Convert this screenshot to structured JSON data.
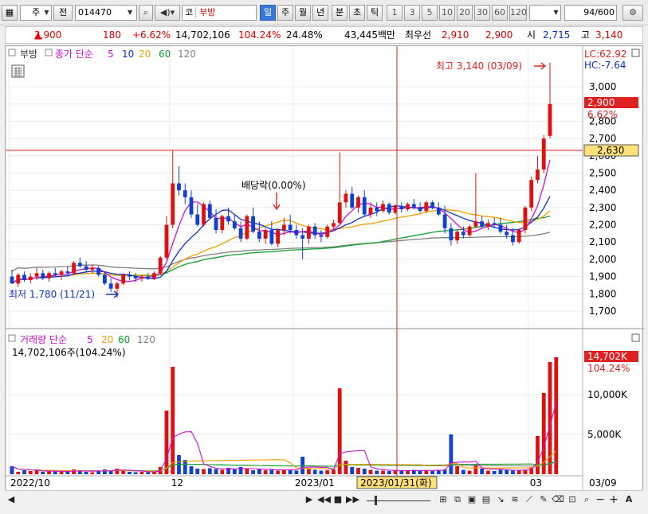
{
  "toolbar": {
    "market_label": "주",
    "type_label": "전",
    "stock_code": "014470",
    "market_kind": "코",
    "stock_name": "부방",
    "periods": [
      "일",
      "주",
      "월",
      "년",
      "분",
      "초",
      "틱"
    ],
    "selected_period": "일",
    "intervals": [
      "1",
      "3",
      "5",
      "10",
      "20",
      "30",
      "60",
      "120"
    ],
    "count": "94",
    "count_total": "/600"
  },
  "quote": {
    "price": "2,900",
    "change_arrow": "▲",
    "change": "180",
    "change_pct": "+6.62%",
    "volume": "14,702,106",
    "volume_ratio": "104.24%",
    "turnover": "24.48%",
    "amount": "43,445백만",
    "pref_label": "최우선",
    "bid": "2,910",
    "ask": "2,900",
    "open_label": "시",
    "open": "2,715",
    "high_label": "고",
    "high": "3,140"
  },
  "price_panel": {
    "name_tag": "부방",
    "legend_label": "종가 단순",
    "ma_periods": [
      "5",
      "10",
      "20",
      "60",
      "120"
    ],
    "lc": "LC:62.92",
    "hc": "HC:-7.64",
    "current_tag": "2,900",
    "pct_tag": "6.62%",
    "crosshair_tag": "2,630",
    "high_note": "최고 3,140 (03/09)",
    "low_note": "최저 1,780 (11/21)",
    "dividend_note": "배당락(0.00%)",
    "y_ticks": [
      "3,000",
      "2,900",
      "2,800",
      "2,700",
      "2,600",
      "2,500",
      "2,400",
      "2,300",
      "2,200",
      "2,100",
      "2,000",
      "1,900",
      "1,800",
      "1,700"
    ]
  },
  "volume_panel": {
    "legend_label": "거래량 단순",
    "ma_periods": [
      "5",
      "20",
      "60",
      "120"
    ],
    "volume_text": "14,702,106주(104.24%)",
    "current_tag": "14,702K",
    "pct_tag": "104.24%",
    "y_ticks": [
      "10,000K",
      "5,000K"
    ]
  },
  "x_axis": {
    "labels": [
      "2022/10",
      "12",
      "2023/01",
      "03"
    ],
    "crosshair_date": "2023/01/31(화)",
    "last_date": "03/09"
  },
  "colors": {
    "up": "#e01010",
    "down": "#1040d0",
    "ma5": "#d010d0",
    "ma10": "#1030c8",
    "ma20": "#f0a000",
    "ma60": "#10a030",
    "ma120": "#808080",
    "selected": "#3a78d8"
  },
  "chart_data": {
    "type": "candlestick",
    "price_ylim": [
      1700,
      3100
    ],
    "x_labels": [
      "2022/10",
      "12",
      "2023/01",
      "03"
    ],
    "candles": [
      [
        1900,
        1940,
        1860,
        1860
      ],
      [
        1860,
        1920,
        1840,
        1910
      ],
      [
        1910,
        1930,
        1870,
        1880
      ],
      [
        1880,
        1920,
        1860,
        1900
      ],
      [
        1900,
        1950,
        1880,
        1920
      ],
      [
        1920,
        1940,
        1880,
        1890
      ],
      [
        1890,
        1930,
        1870,
        1920
      ],
      [
        1920,
        1950,
        1900,
        1910
      ],
      [
        1910,
        1940,
        1880,
        1930
      ],
      [
        1930,
        1960,
        1910,
        1920
      ],
      [
        1920,
        1990,
        1910,
        1980
      ],
      [
        1980,
        2010,
        1950,
        1960
      ],
      [
        1960,
        1990,
        1930,
        1940
      ],
      [
        1940,
        1970,
        1920,
        1950
      ],
      [
        1950,
        1960,
        1900,
        1910
      ],
      [
        1910,
        1930,
        1850,
        1860
      ],
      [
        1860,
        1890,
        1810,
        1830
      ],
      [
        1830,
        1870,
        1780,
        1860
      ],
      [
        1860,
        1920,
        1850,
        1910
      ],
      [
        1910,
        1930,
        1880,
        1900
      ],
      [
        1900,
        1920,
        1870,
        1890
      ],
      [
        1890,
        1910,
        1870,
        1900
      ],
      [
        1900,
        1920,
        1880,
        1890
      ],
      [
        1890,
        1930,
        1880,
        1920
      ],
      [
        1920,
        2020,
        1910,
        2010
      ],
      [
        2010,
        2250,
        2000,
        2200
      ],
      [
        2200,
        2630,
        2180,
        2440
      ],
      [
        2440,
        2540,
        2370,
        2400
      ],
      [
        2400,
        2440,
        2320,
        2360
      ],
      [
        2360,
        2400,
        2240,
        2260
      ],
      [
        2260,
        2320,
        2190,
        2200
      ],
      [
        2200,
        2330,
        2190,
        2320
      ],
      [
        2320,
        2340,
        2230,
        2240
      ],
      [
        2240,
        2290,
        2150,
        2170
      ],
      [
        2170,
        2260,
        2150,
        2250
      ],
      [
        2250,
        2300,
        2200,
        2220
      ],
      [
        2220,
        2260,
        2170,
        2180
      ],
      [
        2180,
        2220,
        2100,
        2120
      ],
      [
        2120,
        2260,
        2110,
        2250
      ],
      [
        2250,
        2300,
        2150,
        2160
      ],
      [
        2160,
        2220,
        2100,
        2120
      ],
      [
        2120,
        2180,
        2090,
        2170
      ],
      [
        2170,
        2220,
        2080,
        2090
      ],
      [
        2090,
        2180,
        2070,
        2170
      ],
      [
        2170,
        2240,
        2140,
        2200
      ],
      [
        2200,
        2260,
        2150,
        2170
      ],
      [
        2170,
        2200,
        2120,
        2140
      ],
      [
        2140,
        2180,
        2000,
        2120
      ],
      [
        2120,
        2200,
        2090,
        2190
      ],
      [
        2190,
        2210,
        2120,
        2140
      ],
      [
        2140,
        2170,
        2100,
        2130
      ],
      [
        2130,
        2200,
        2120,
        2190
      ],
      [
        2190,
        2230,
        2170,
        2210
      ],
      [
        2210,
        2620,
        2200,
        2330
      ],
      [
        2330,
        2400,
        2300,
        2380
      ],
      [
        2380,
        2420,
        2290,
        2300
      ],
      [
        2300,
        2370,
        2270,
        2360
      ],
      [
        2360,
        2400,
        2250,
        2260
      ],
      [
        2260,
        2330,
        2240,
        2300
      ],
      [
        2300,
        2330,
        2250,
        2280
      ],
      [
        2280,
        2340,
        2270,
        2320
      ],
      [
        2320,
        2330,
        2260,
        2270
      ],
      [
        2270,
        2320,
        2260,
        2310
      ],
      [
        2310,
        2330,
        2270,
        2290
      ],
      [
        2290,
        2330,
        2280,
        2320
      ],
      [
        2320,
        2350,
        2290,
        2300
      ],
      [
        2300,
        2330,
        2270,
        2280
      ],
      [
        2280,
        2340,
        2270,
        2330
      ],
      [
        2330,
        2340,
        2290,
        2300
      ],
      [
        2300,
        2330,
        2250,
        2260
      ],
      [
        2260,
        2310,
        2150,
        2180
      ],
      [
        2180,
        2210,
        2080,
        2110
      ],
      [
        2110,
        2170,
        2090,
        2160
      ],
      [
        2160,
        2190,
        2120,
        2140
      ],
      [
        2140,
        2200,
        2130,
        2190
      ],
      [
        2190,
        2500,
        2180,
        2220
      ],
      [
        2220,
        2250,
        2180,
        2190
      ],
      [
        2190,
        2230,
        2170,
        2210
      ],
      [
        2210,
        2240,
        2180,
        2200
      ],
      [
        2200,
        2240,
        2150,
        2160
      ],
      [
        2160,
        2200,
        2120,
        2140
      ],
      [
        2140,
        2180,
        2080,
        2100
      ],
      [
        2100,
        2180,
        2090,
        2170
      ],
      [
        2170,
        2310,
        2150,
        2300
      ],
      [
        2300,
        2480,
        2280,
        2460
      ],
      [
        2460,
        2600,
        2440,
        2520
      ],
      [
        2520,
        2720,
        2500,
        2700
      ],
      [
        2715,
        3140,
        2700,
        2900
      ]
    ],
    "volume_ylim": [
      0,
      15000
    ],
    "volumes": [
      1000,
      300,
      500,
      400,
      450,
      300,
      350,
      400,
      300,
      350,
      600,
      400,
      300,
      250,
      450,
      600,
      500,
      700,
      400,
      300,
      250,
      300,
      250,
      350,
      900,
      8000,
      13500,
      2400,
      1800,
      1000,
      700,
      650,
      750,
      650,
      550,
      800,
      600,
      900,
      700,
      500,
      600,
      500,
      650,
      450,
      550,
      600,
      450,
      2200,
      650,
      550,
      450,
      500,
      600,
      10800,
      1700,
      900,
      800,
      700,
      550,
      450,
      450,
      400,
      500,
      400,
      450,
      550,
      450,
      500,
      400,
      550,
      600,
      5000,
      1000,
      550,
      450,
      1200,
      700,
      450,
      400,
      550,
      600,
      500,
      450,
      550,
      900,
      4800,
      10200,
      14100,
      14702
    ]
  }
}
